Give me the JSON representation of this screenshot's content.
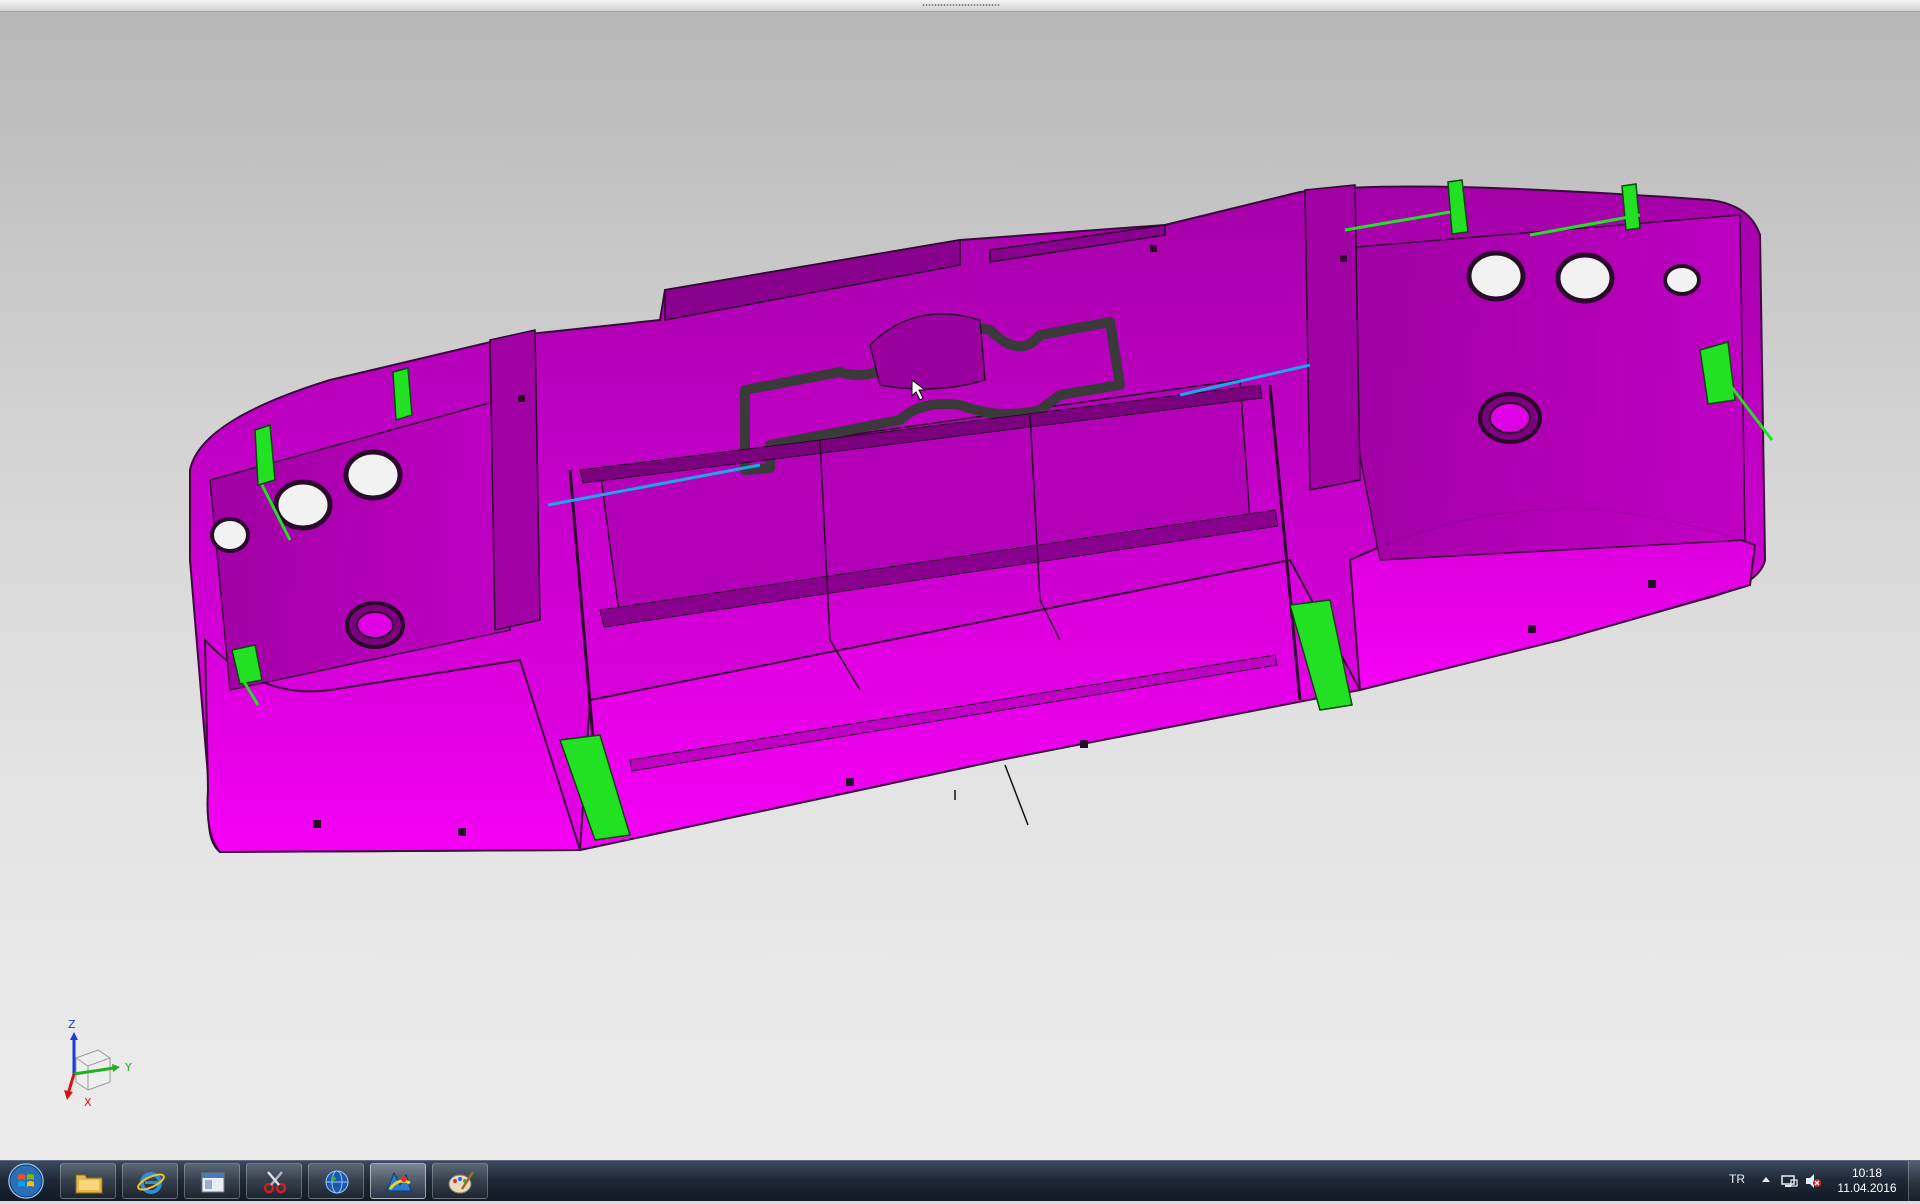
{
  "viewport": {
    "model_icon": "3d-bumper-model",
    "model_color": "#e100e1",
    "clip_color": "#22e022",
    "edge_color": "#2a1a2a",
    "triad": {
      "z_label": "Z",
      "y_label": "Y",
      "x_label": "X"
    }
  },
  "taskbar": {
    "start_icon": "windows-start-orb",
    "buttons": [
      {
        "name": "file-explorer",
        "icon": "folder-icon",
        "active": false
      },
      {
        "name": "internet-explorer",
        "icon": "ie-icon",
        "active": false
      },
      {
        "name": "window-app",
        "icon": "window-icon",
        "active": false
      },
      {
        "name": "snipping-tool",
        "icon": "scissors-icon",
        "active": false
      },
      {
        "name": "globe-app",
        "icon": "globe-icon",
        "active": false
      },
      {
        "name": "cad-application",
        "icon": "cad-app-icon",
        "active": true
      },
      {
        "name": "paint-app",
        "icon": "palette-icon",
        "active": false
      }
    ],
    "tray": {
      "language": "TR",
      "time": "10:18",
      "date": "11.04.2016"
    }
  }
}
